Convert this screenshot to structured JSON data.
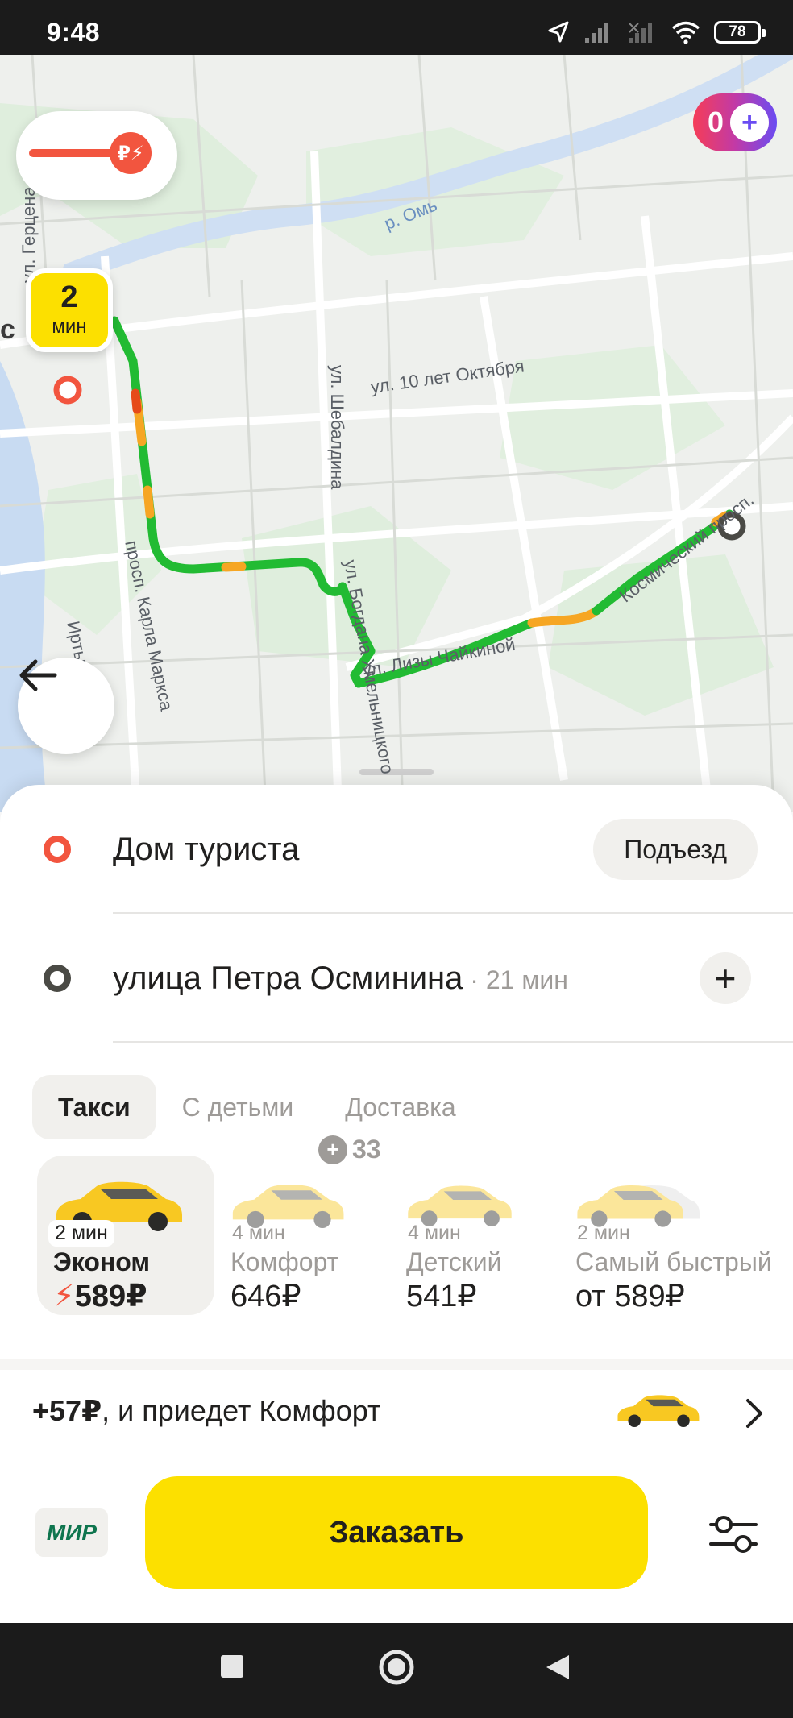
{
  "status_bar": {
    "time": "9:48",
    "battery": "78"
  },
  "map": {
    "labels": {
      "river_om": "р. Омь",
      "gertsena": "ул. Герцена",
      "oktyabrya": "ул. 10 лет Октября",
      "shebaldina": "ул. Шебалдина",
      "kosmicheskiy": "Космический просп.",
      "marksa": "просп. Карла Маркса",
      "khmelnitskogo": "ул. Богдана Хмельницкого",
      "chaykinoy": "ул. Лизы Чайкиной",
      "irtysh": "Иртыш",
      "city_fragment": "с"
    },
    "surge_symbol": "₽⚡",
    "plus_balance": "0",
    "plus_symbol": "+",
    "pickup_eta": {
      "value": "2",
      "unit": "мин"
    }
  },
  "route": {
    "from": {
      "label": "Дом туриста",
      "button": "Подъезд"
    },
    "to": {
      "label": "улица Петра Осминина",
      "duration": " · 21 мин",
      "add_button": "+"
    }
  },
  "tabs": [
    {
      "label": "Такси",
      "active": true
    },
    {
      "label": "С детьми",
      "active": false
    },
    {
      "label": "Доставка",
      "active": false
    }
  ],
  "tariffs": [
    {
      "eta": "2 мин",
      "name": "Эконом",
      "price": "589₽",
      "selected": true,
      "surge": true
    },
    {
      "eta": "4 мин",
      "name": "Комфорт",
      "price": "646₽",
      "selected": false,
      "cashback": "33"
    },
    {
      "eta": "4 мин",
      "name": "Детский",
      "price": "541₽",
      "selected": false
    },
    {
      "eta": "2 мин",
      "name": "Самый быстрый",
      "price": "от 589₽",
      "selected": false
    }
  ],
  "upsell": {
    "amount": "+57₽",
    "text": ", и приедет Комфорт"
  },
  "payment": {
    "label": "МИР"
  },
  "order_button": "Заказать",
  "colors": {
    "brand_yellow": "#fce000",
    "accent_red": "#f2553f",
    "route_green": "#22bb33",
    "route_orange": "#f6a623"
  }
}
